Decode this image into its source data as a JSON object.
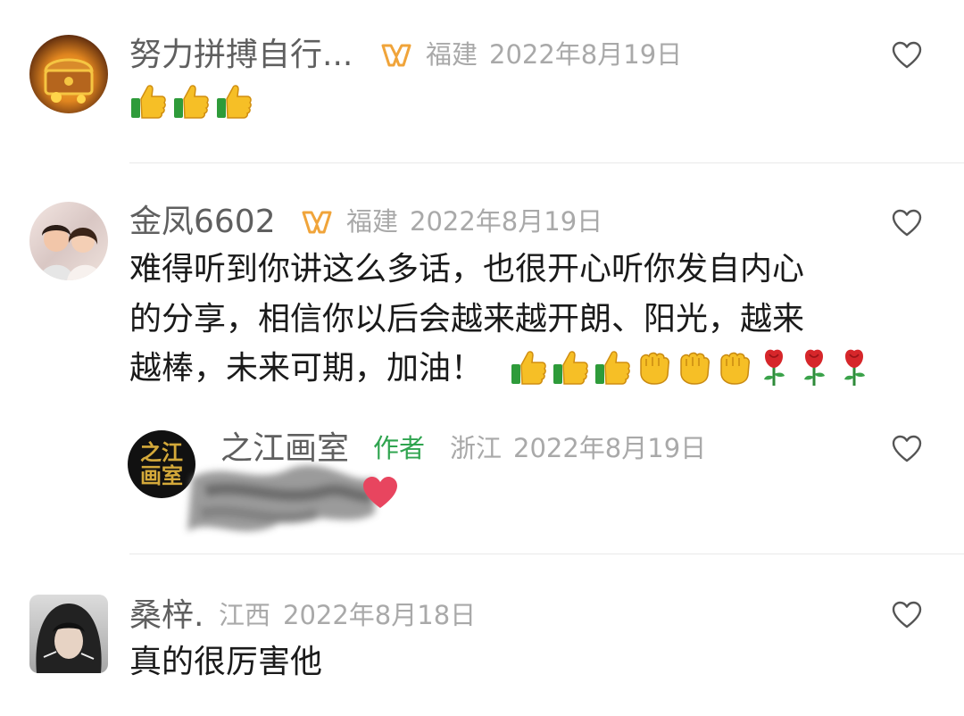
{
  "comments": [
    {
      "username": "努力拼搏自行...",
      "location": "福建",
      "date": "2022年8月19日",
      "content": "",
      "emojis": [
        "thumbs-up",
        "thumbs-up",
        "thumbs-up"
      ]
    },
    {
      "username": "金凤6602",
      "location": "福建",
      "date": "2022年8月19日",
      "content_lines": [
        "难得听到你讲这么多话，也很开心听你发自内心",
        "的分享，相信你以后会越来越开朗、阳光，越来",
        "越棒，未来可期，加油！"
      ],
      "emojis": [
        "thumbs-up",
        "thumbs-up",
        "thumbs-up",
        "fist",
        "fist",
        "fist",
        "rose",
        "rose",
        "rose"
      ]
    },
    {
      "username": "之江画室",
      "author_tag": "作者",
      "location": "浙江",
      "date": "2022年8月19日",
      "avatar_text": "之江画室",
      "emojis": [
        "heart"
      ]
    },
    {
      "username": "桑梓.",
      "location": "江西",
      "date": "2022年8月18日",
      "content": "真的很厉害他"
    }
  ],
  "colors": {
    "username": "#5f5f5f",
    "meta": "#a9a9a9",
    "author_tag": "#2fa44f",
    "body": "#1a1a1a"
  }
}
